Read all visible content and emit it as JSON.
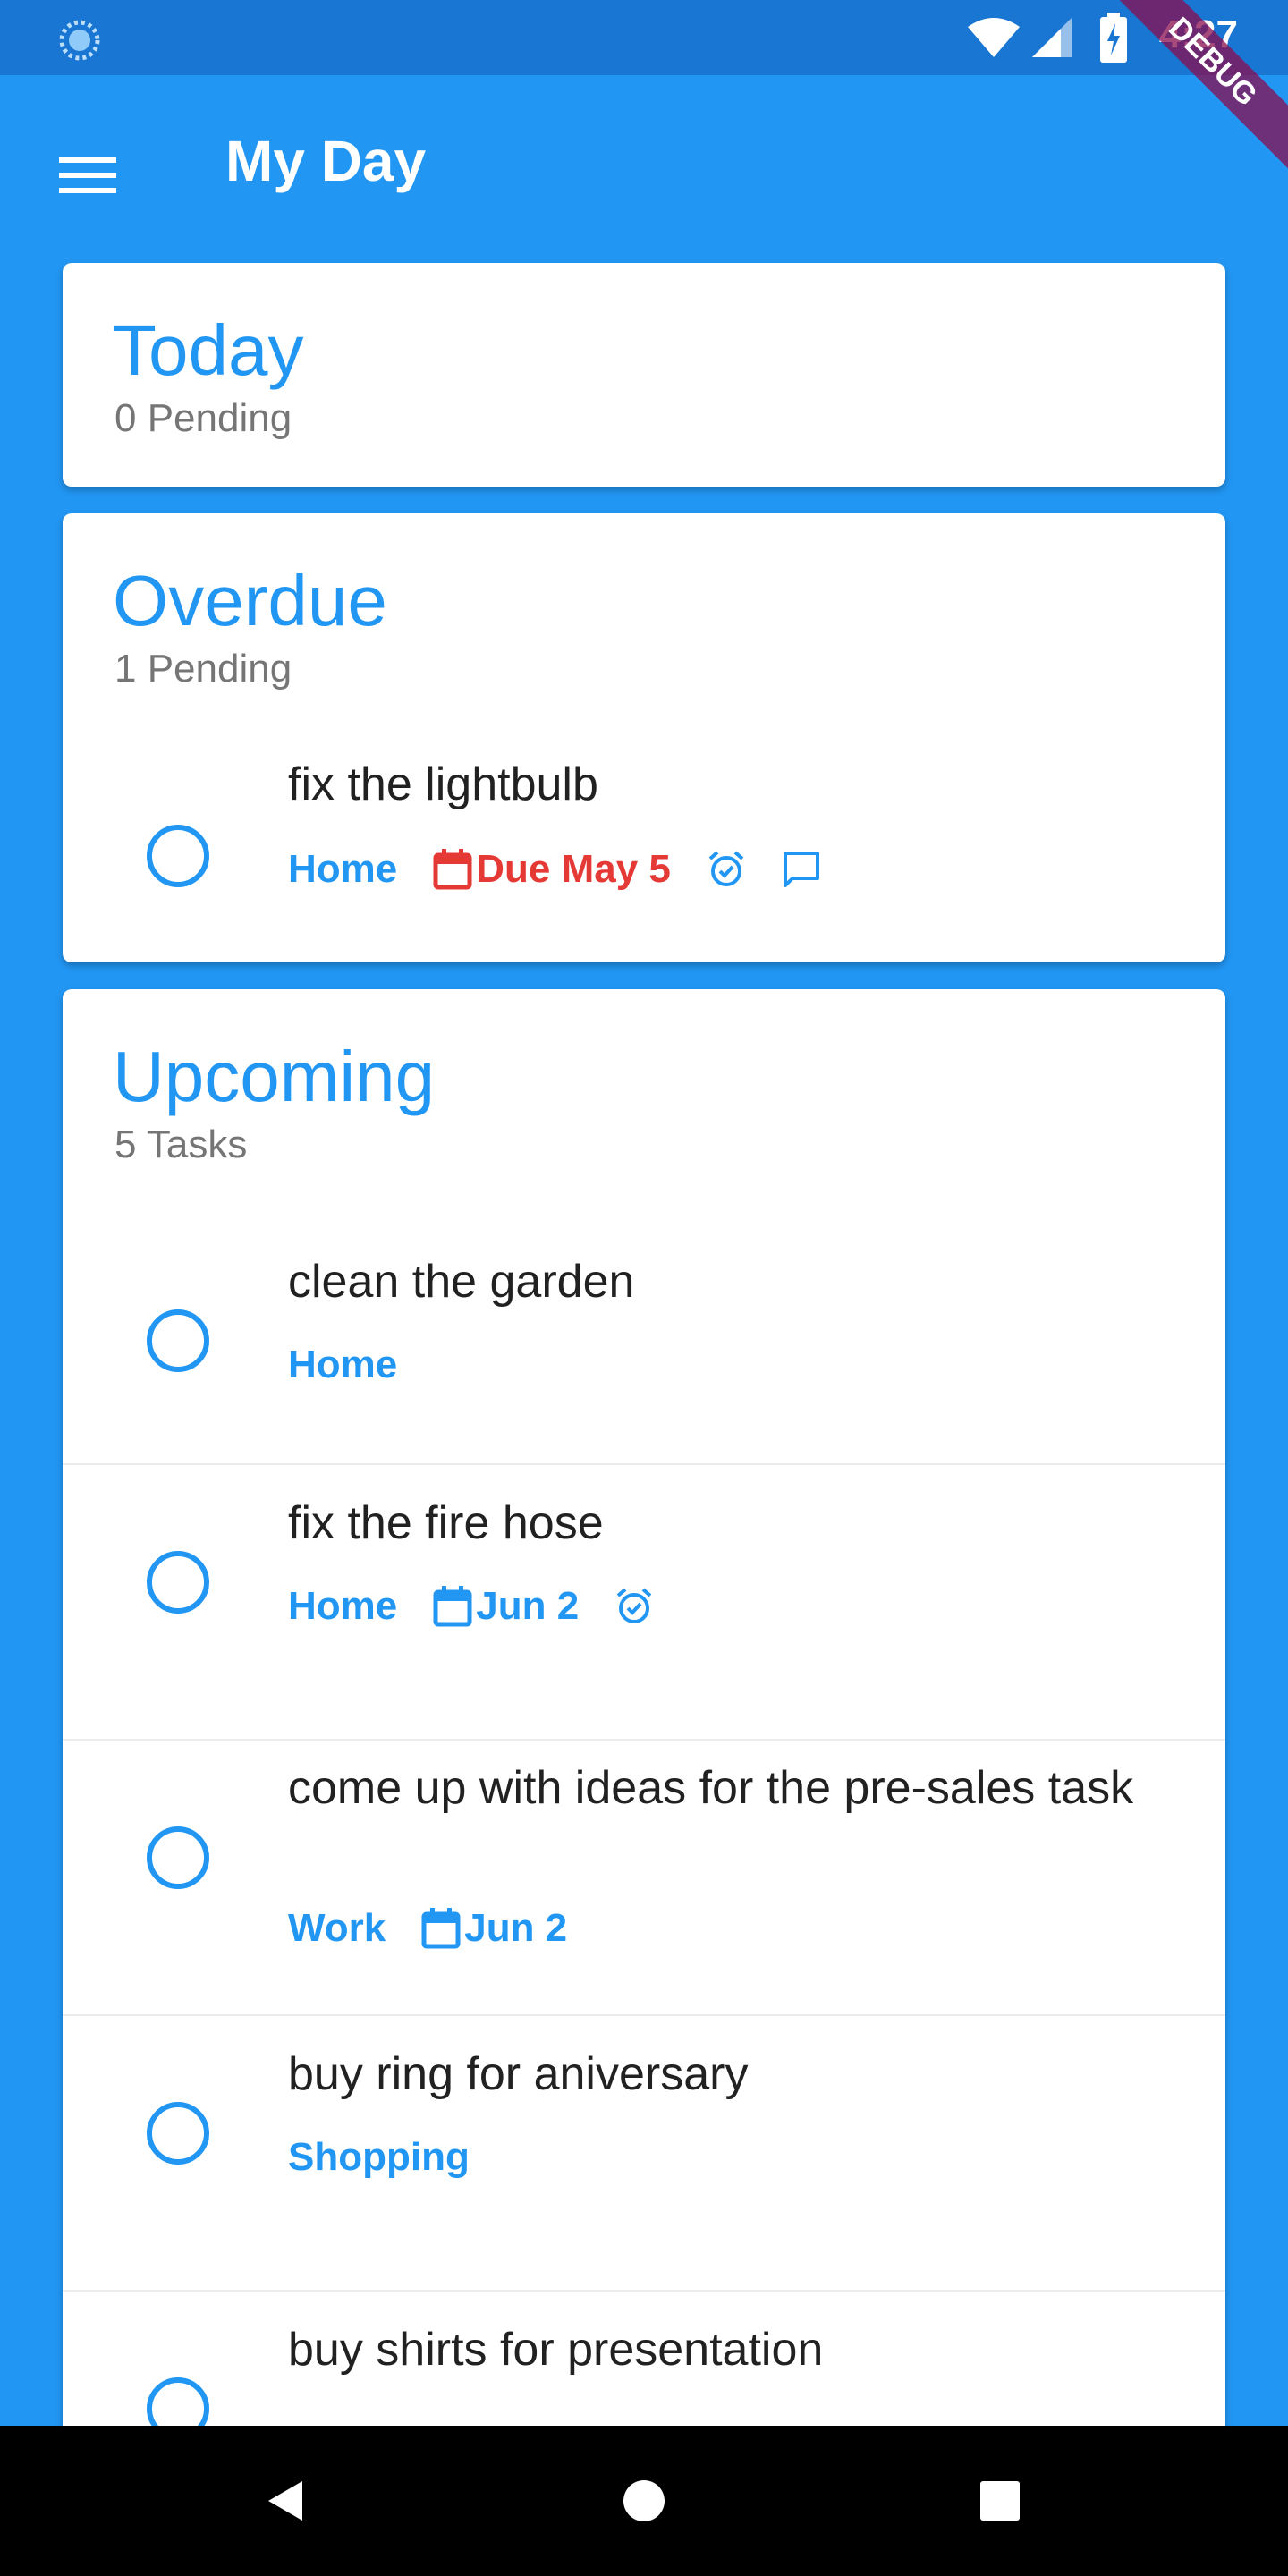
{
  "colors": {
    "primary": "#2196f3",
    "primary_dark": "#1976d2",
    "overdue": "#e53935",
    "text": "#212121",
    "muted": "#757575"
  },
  "status_bar": {
    "time": "4:27"
  },
  "debug_banner": {
    "label": "DEBUG"
  },
  "app_bar": {
    "title": "My Day",
    "menu_icon": "hamburger-menu-icon"
  },
  "sections": {
    "today": {
      "title": "Today",
      "subtitle": "0 Pending"
    },
    "overdue": {
      "title": "Overdue",
      "subtitle": "1 Pending",
      "tasks": [
        {
          "title": "fix the lightbulb",
          "project": "Home",
          "due": "Due May 5",
          "icons": [
            "alarm-icon",
            "comment-icon"
          ]
        }
      ]
    },
    "upcoming": {
      "title": "Upcoming",
      "subtitle": "5 Tasks",
      "tasks": [
        {
          "title": "clean the garden",
          "project": "Home"
        },
        {
          "title": "fix the fire hose",
          "project": "Home",
          "due": "Jun 2",
          "icons": [
            "alarm-icon"
          ]
        },
        {
          "title": "come up with ideas for the pre-sales task",
          "project": "Work",
          "due": "Jun 2"
        },
        {
          "title": "buy ring for aniversary",
          "project": "Shopping"
        },
        {
          "title": "buy shirts for presentation"
        }
      ]
    }
  },
  "nav_bar": {
    "icons": [
      "back-icon",
      "home-icon",
      "recents-icon"
    ]
  }
}
